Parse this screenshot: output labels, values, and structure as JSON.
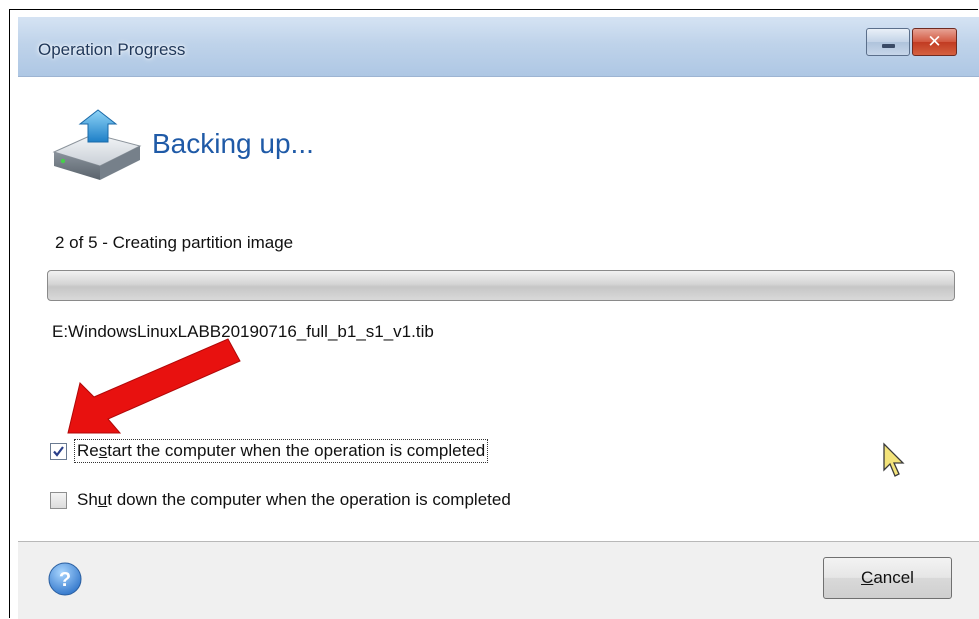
{
  "window": {
    "title": "Operation Progress",
    "minimize_icon": "minimize-icon",
    "close_icon": "close-icon",
    "close_glyph": "✕"
  },
  "main": {
    "icon": "drive-backup-icon",
    "heading": "Backing up...",
    "step_text": "2 of 5 - Creating partition image",
    "progress": 0,
    "file_path": "E:WindowsLinuxLABB20190716_full_b1_s1_v1.tib"
  },
  "options": {
    "restart": {
      "checked": true,
      "label_pre": "Re",
      "label_ul": "s",
      "label_post": "tart the computer when the operation is completed"
    },
    "shutdown": {
      "checked": false,
      "label_pre": "Sh",
      "label_ul": "u",
      "label_post": "t down the computer when the operation is completed"
    }
  },
  "footer": {
    "help_icon": "help-icon",
    "cancel_ul": "C",
    "cancel_rest": "ancel"
  },
  "colors": {
    "heading": "#1f5aa7",
    "annotation_arrow": "#e8110f",
    "help_icon": "#3b86d8"
  }
}
